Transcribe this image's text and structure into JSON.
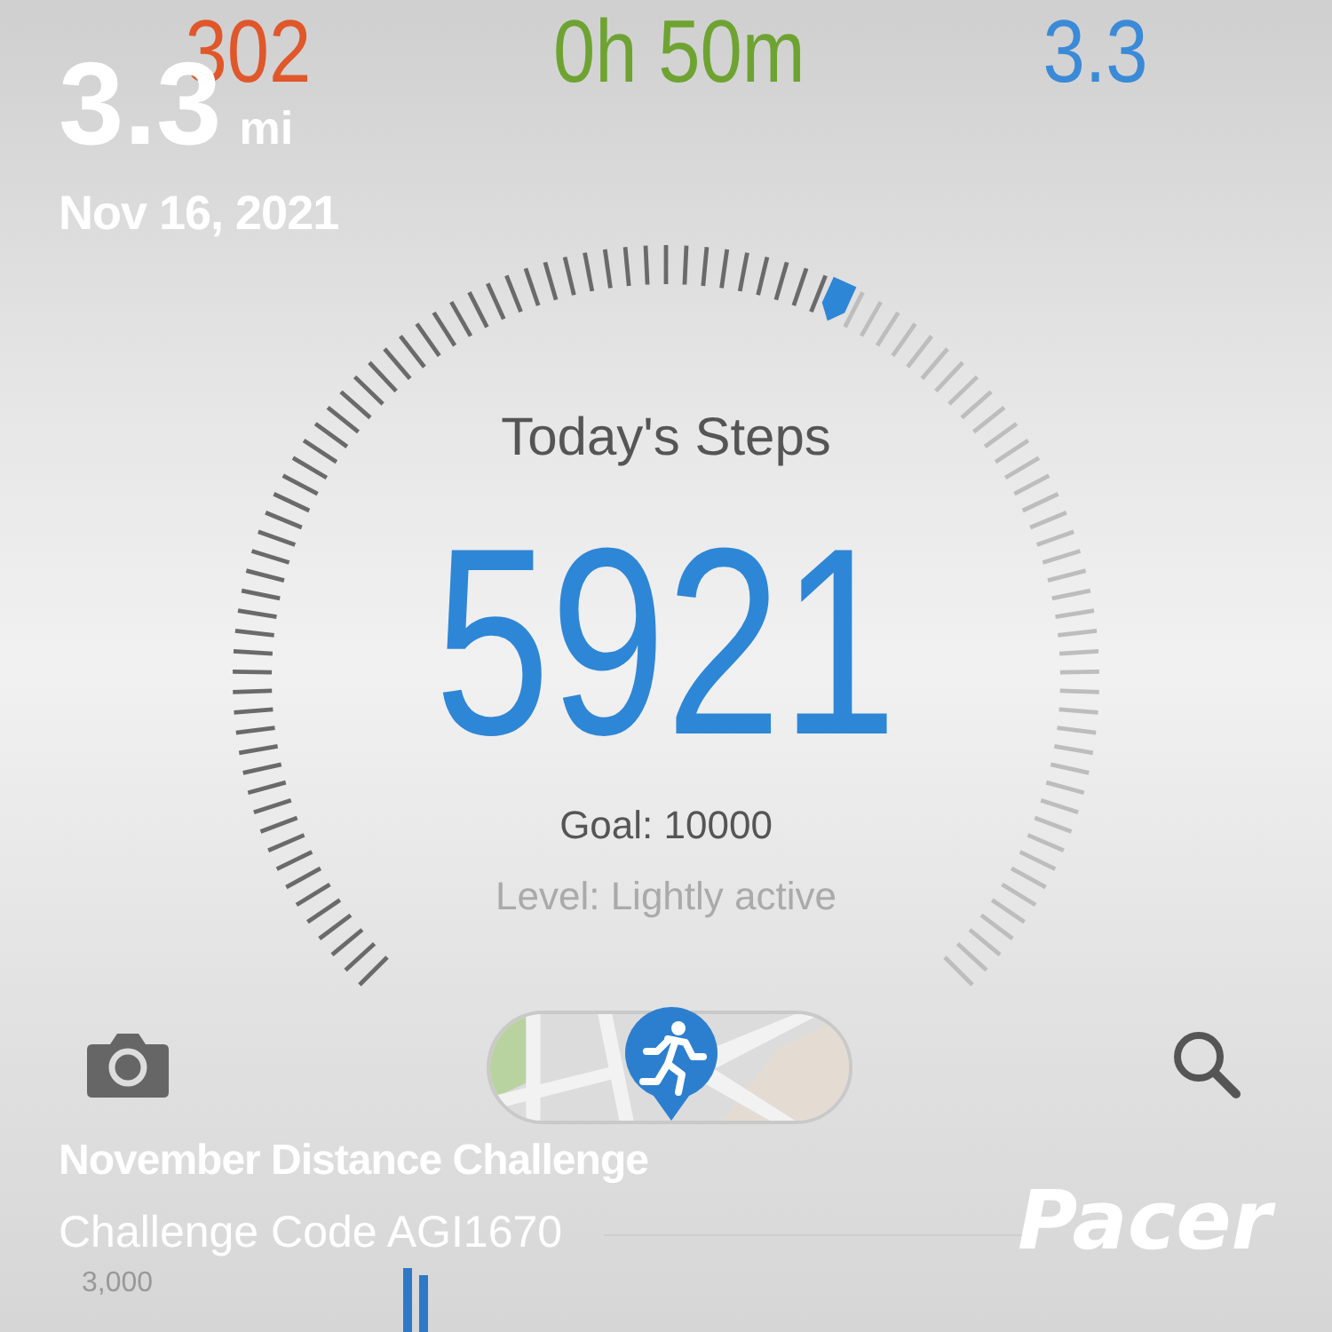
{
  "stats": [
    {
      "value": "302",
      "color": "#e0572a"
    },
    {
      "value": "0h 50m",
      "color": "#6ea332"
    },
    {
      "value": "3.3",
      "color": "#3a8ad8"
    }
  ],
  "steps": {
    "title": "Today's Steps",
    "count": "5921",
    "goal": "Goal: 10000",
    "activity_level": "Level: Lightly active"
  },
  "chart": {
    "axis_label": "3,000"
  },
  "overlay": {
    "distance": "3.3",
    "unit": "mi",
    "date": "Nov 16, 2021",
    "challenge_name": "November Distance Challenge",
    "challenge_code": "Challenge Code AGI1670",
    "logo": "Pacer"
  }
}
